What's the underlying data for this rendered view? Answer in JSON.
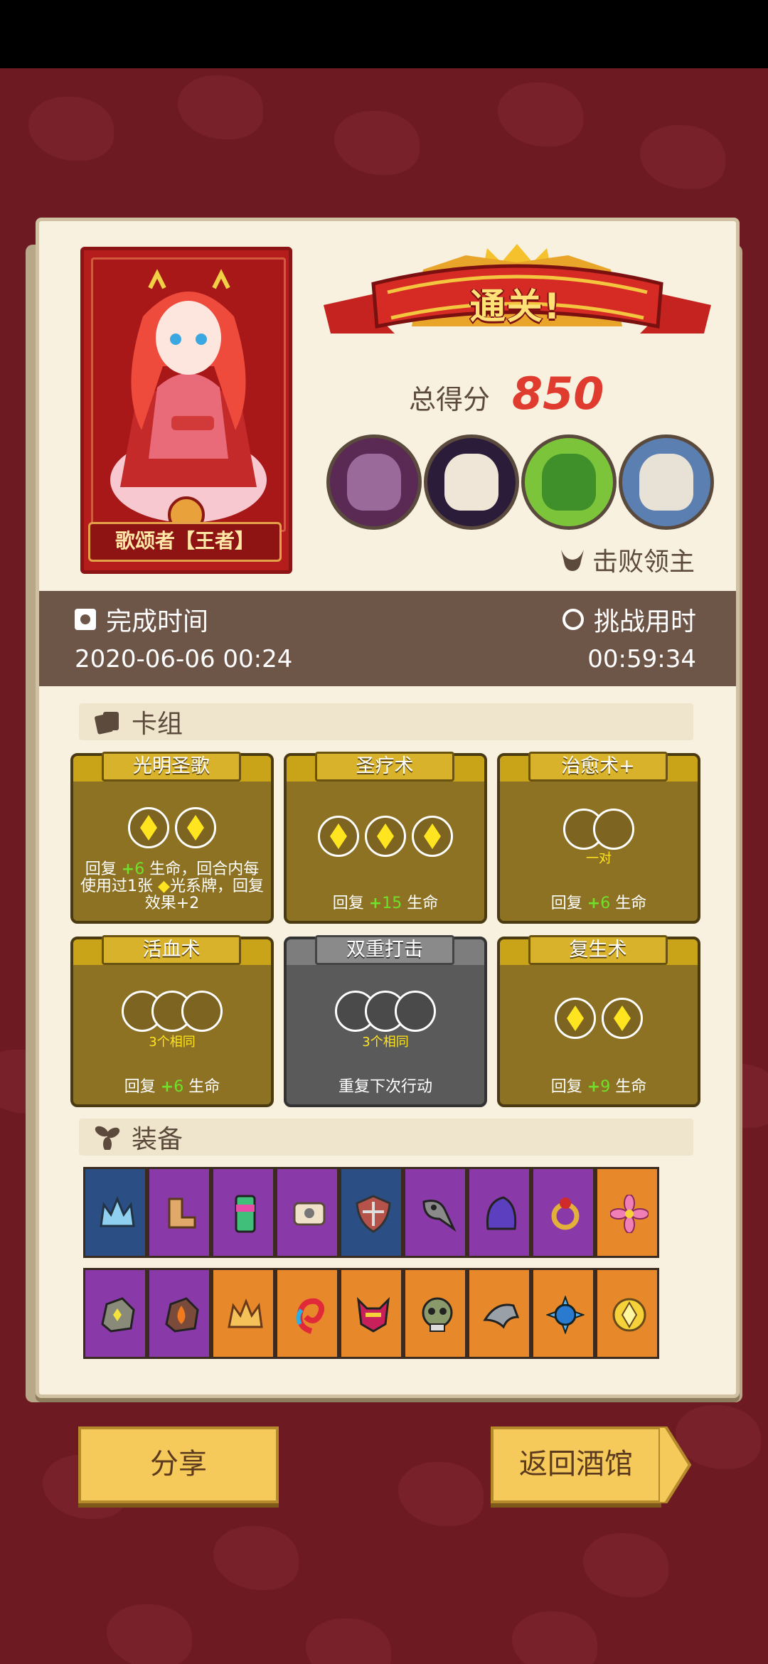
{
  "result": {
    "banner": "通关!",
    "score_label": "总得分",
    "score": "850",
    "defeat_label": "击败领主"
  },
  "hero": {
    "name": "歌颂者【王者】"
  },
  "bosses": [
    "boss-1",
    "boss-2",
    "boss-3",
    "boss-4"
  ],
  "time": {
    "finish_label": "完成时间",
    "finish_value": "2020-06-06 00:24",
    "duration_label": "挑战用时",
    "duration_value": "00:59:34"
  },
  "deck": {
    "title": "卡组",
    "cards": [
      {
        "name": "光明圣歌",
        "desc_pre": "回复 ",
        "plus": "+",
        "amount": "6",
        "desc_post": " 生命，回合内每使用过1张 ",
        "dia": "◆",
        "desc_tail": "光系牌，回复效果+2"
      },
      {
        "name": "圣疗术",
        "desc_pre": "回复 ",
        "plus": "+",
        "amount": "15",
        "desc_post": " 生命"
      },
      {
        "name": "治愈术+",
        "slot_note": "一对",
        "desc_pre": "回复 ",
        "plus": "+",
        "amount": "6",
        "desc_post": " 生命"
      },
      {
        "name": "活血术",
        "slot_note": "3个相同",
        "desc_pre": "回复 ",
        "plus": "+",
        "amount": "6",
        "desc_post": " 生命"
      },
      {
        "name": "双重打击",
        "slot_note": "3个相同",
        "desc": "重复下次行动"
      },
      {
        "name": "复生术",
        "desc_pre": "回复 ",
        "plus": "+",
        "amount": "9",
        "desc_post": " 生命"
      }
    ]
  },
  "equipment": {
    "title": "装备",
    "row1": [
      "crown-icon",
      "boots-icon",
      "totem-icon",
      "scroll-icon",
      "shield-icon",
      "plague-mask-icon",
      "hood-icon",
      "ring-icon",
      "flower-icon"
    ],
    "row2": [
      "rock-icon",
      "fire-stone-icon",
      "crown-shard-icon",
      "red-hook-icon",
      "demon-mask-icon",
      "skull-icon",
      "shark-icon",
      "spiked-ball-icon",
      "gem-icon"
    ]
  },
  "buttons": {
    "share": "分享",
    "back": "返回酒馆"
  },
  "colors": {
    "bg": "#6d1a22",
    "paper": "#f8f1df",
    "band": "#6d5547",
    "score": "#e03b2f",
    "button": "#f6c95b"
  }
}
